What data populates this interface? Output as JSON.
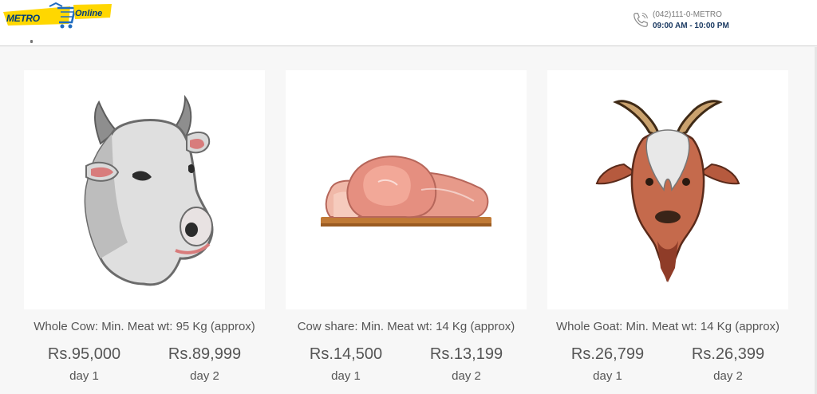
{
  "header": {
    "logo": {
      "metro_text": "METRO",
      "online_text": "Online"
    },
    "contact": {
      "phone_icon": "phone-icon",
      "phone": "(042)111-0-METRO",
      "hours": "09:00 AM - 10:00 PM"
    }
  },
  "products": [
    {
      "icon": "cow-icon",
      "title": "Whole Cow: Min. Meat wt: 95 Kg (approx)",
      "prices": [
        {
          "amount": "Rs.95,000",
          "label": "day 1"
        },
        {
          "amount": "Rs.89,999",
          "label": "day 2"
        }
      ]
    },
    {
      "icon": "meat-icon",
      "title": "Cow share: Min. Meat wt: 14 Kg (approx)",
      "prices": [
        {
          "amount": "Rs.14,500",
          "label": "day 1"
        },
        {
          "amount": "Rs.13,199",
          "label": "day 2"
        }
      ]
    },
    {
      "icon": "goat-icon",
      "title": "Whole Goat: Min. Meat wt: 14 Kg (approx)",
      "prices": [
        {
          "amount": "Rs.26,799",
          "label": "day 1"
        },
        {
          "amount": "Rs.26,399",
          "label": "day 2"
        }
      ]
    }
  ],
  "colors": {
    "brand_blue": "#003d7a",
    "brand_yellow": "#ffd700",
    "text": "#555555"
  }
}
